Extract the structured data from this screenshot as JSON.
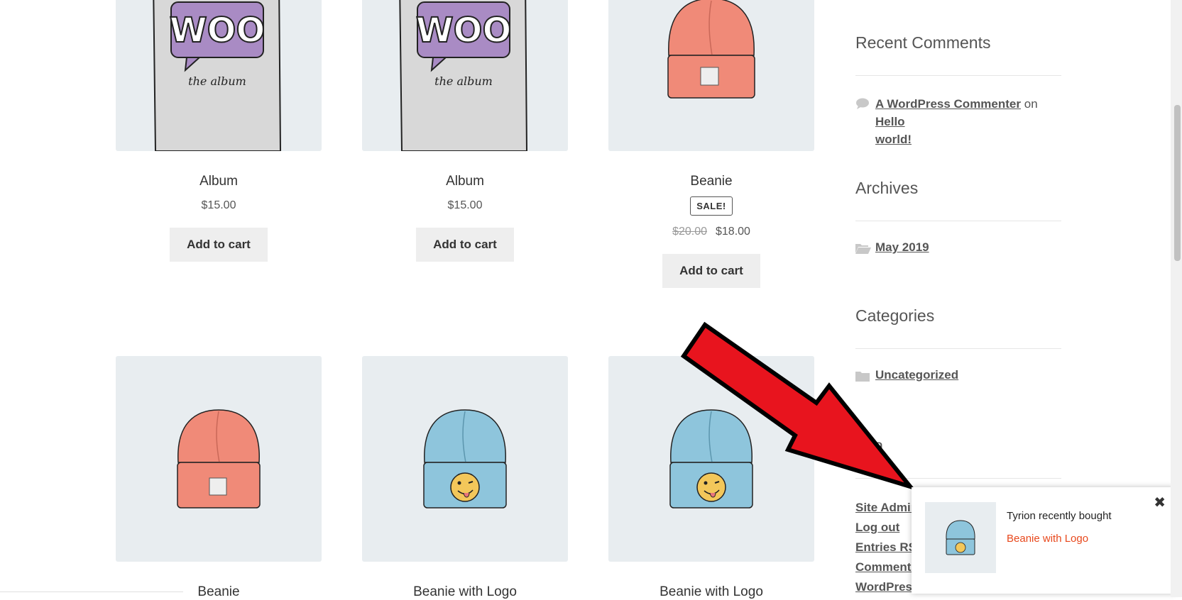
{
  "products": [
    {
      "name": "Album",
      "price": "$15.00",
      "button": "Add to cart",
      "image": "woo-album"
    },
    {
      "name": "Album",
      "price": "$15.00",
      "button": "Add to cart",
      "image": "woo-album"
    },
    {
      "name": "Beanie",
      "badge": "SALE!",
      "old_price": "$20.00",
      "price": "$18.00",
      "button": "Add to cart",
      "image": "orange-beanie"
    },
    {
      "name": "Beanie",
      "image": "orange-beanie"
    },
    {
      "name": "Beanie with Logo",
      "image": "blue-beanie-logo"
    },
    {
      "name": "Beanie with Logo",
      "image": "blue-beanie-logo"
    }
  ],
  "album_art": {
    "brand": "WOO",
    "subtitle": "the album"
  },
  "sidebar": {
    "recent_comments": {
      "title": "Recent Comments",
      "author": "A WordPress Commenter",
      "connector": "on",
      "post_line1": "Hello",
      "post_line2": "world!"
    },
    "archives": {
      "title": "Archives",
      "item": "May 2019"
    },
    "categories": {
      "title": "Categories",
      "item": "Uncategorized"
    },
    "meta": {
      "title_fragment": "ta",
      "items": [
        "Site Admin",
        "Log out",
        "Entries RSS",
        "Comments",
        "WordPress"
      ]
    }
  },
  "notification": {
    "text": "Tyrion recently bought",
    "product": "Beanie with Logo",
    "close": "✖",
    "product_image": "blue-beanie-logo"
  },
  "colors": {
    "arrow": "#e8141e",
    "link_accent": "#e8481c",
    "thumb_bg": "#e8edf0",
    "button_bg": "#eeeeee"
  }
}
